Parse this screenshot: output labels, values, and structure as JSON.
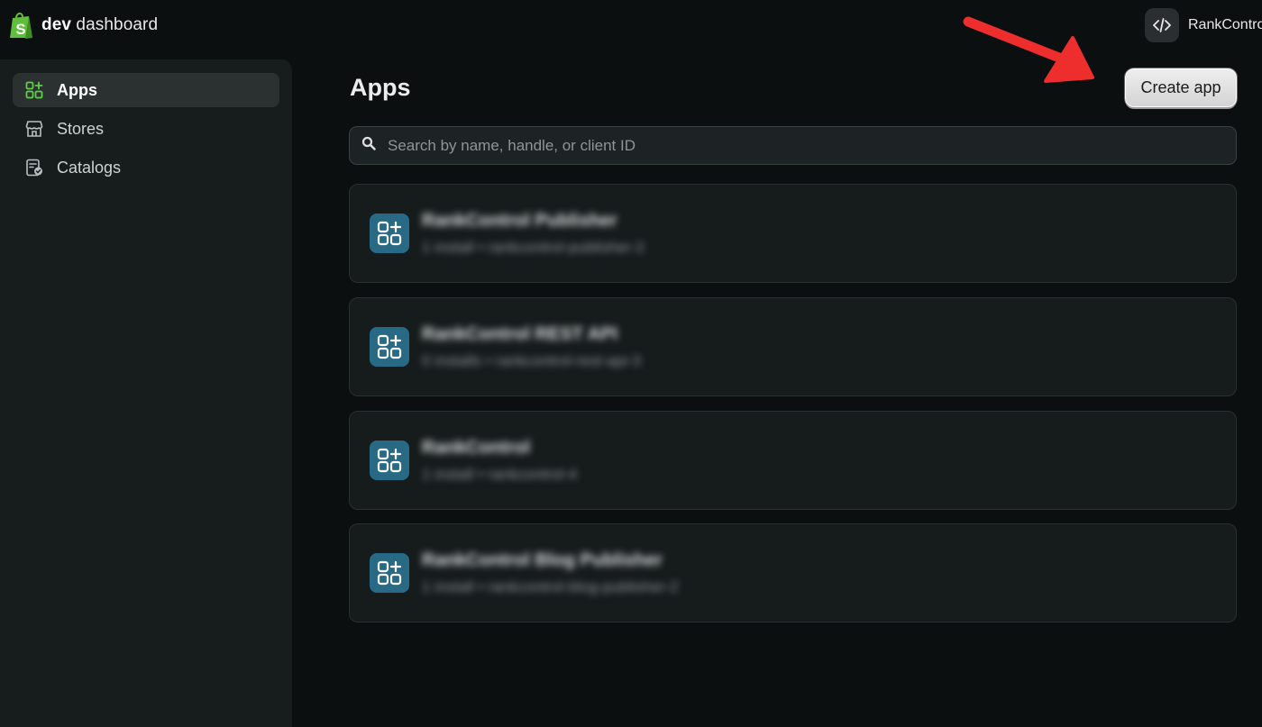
{
  "brand": {
    "bold": "dev",
    "rest": " dashboard"
  },
  "org": {
    "name": "RankContro"
  },
  "sidebar": {
    "items": [
      {
        "label": "Apps",
        "icon": "apps-icon",
        "active": true
      },
      {
        "label": "Stores",
        "icon": "store-icon",
        "active": false
      },
      {
        "label": "Catalogs",
        "icon": "catalog-icon",
        "active": false
      }
    ]
  },
  "page": {
    "title": "Apps",
    "create_label": "Create app"
  },
  "search": {
    "placeholder": "Search by name, handle, or client ID",
    "value": ""
  },
  "apps": [
    {
      "name": "RankControl Publisher",
      "meta": "1 install • rankcontrol-publisher-2"
    },
    {
      "name": "RankControl REST API",
      "meta": "0 installs • rankcontrol-rest-api-3"
    },
    {
      "name": "RankControl",
      "meta": "1 install • rankcontrol-4"
    },
    {
      "name": "RankControl Blog Publisher",
      "meta": "1 install • rankcontrol-blog-publisher-2"
    }
  ],
  "colors": {
    "accent_green": "#5fcf4a",
    "app_icon_bg": "#286a86",
    "annotation_arrow": "#ee2d2d"
  }
}
